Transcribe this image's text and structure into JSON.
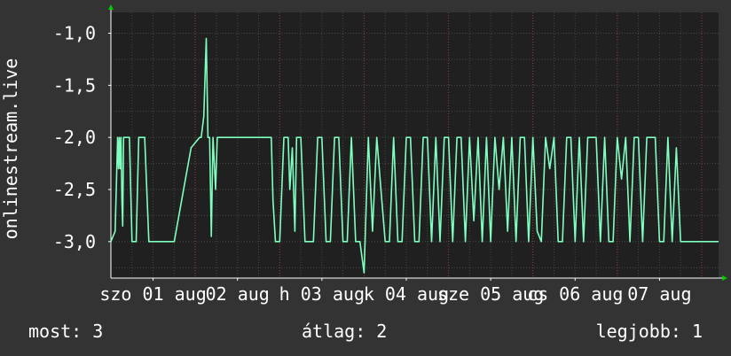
{
  "chart_data": {
    "type": "line",
    "ylabel": "onlinestream.live",
    "ylim": [
      -3.35,
      -0.8
    ],
    "y_ticks": [
      {
        "value": -1.0,
        "label": "-1,0"
      },
      {
        "value": -1.5,
        "label": "-1,5"
      },
      {
        "value": -2.0,
        "label": "-2,0"
      },
      {
        "value": -2.5,
        "label": "-2,5"
      },
      {
        "value": -3.0,
        "label": "-3,0"
      }
    ],
    "x_tick_labels": [
      "szo 01 aug",
      "02 aug",
      "h 03 aug",
      "k 04 aug",
      "sze 05 aug",
      "cs 06 aug",
      "07 aug"
    ],
    "x_tick_positions": [
      0.5,
      1.5,
      2.5,
      3.5,
      4.5,
      5.5,
      6.5
    ],
    "xlim": [
      0,
      7.2
    ],
    "grid": true,
    "line_color": "#7fffbf",
    "series": [
      {
        "x": [
          0,
          0.05,
          0.08,
          0.09,
          0.1,
          0.11,
          0.12,
          0.13,
          0.14,
          0.15,
          0.16,
          0.18,
          0.2,
          0.22,
          0.25,
          0.3,
          0.33,
          0.35,
          0.4,
          0.45,
          0.6,
          0.75,
          0.95,
          1.05,
          1.07,
          1.1,
          1.13,
          1.15,
          1.17,
          1.19,
          1.21,
          1.24,
          1.26,
          1.28,
          1.3,
          1.33,
          1.36,
          1.38,
          1.4,
          1.42,
          1.45,
          1.5,
          1.7,
          1.9,
          1.92,
          1.95,
          2.0,
          2.05,
          2.1,
          2.12,
          2.15,
          2.18,
          2.2,
          2.22,
          2.25,
          2.3,
          2.4,
          2.45,
          2.5,
          2.55,
          2.6,
          2.65,
          2.7,
          2.75,
          2.8,
          2.85,
          2.9,
          2.95,
          3.0,
          3.05,
          3.1,
          3.15,
          3.2,
          3.25,
          3.3,
          3.35,
          3.4,
          3.45,
          3.5,
          3.55,
          3.6,
          3.65,
          3.7,
          3.75,
          3.8,
          3.85,
          3.9,
          3.95,
          4.0,
          4.05,
          4.1,
          4.15,
          4.2,
          4.25,
          4.3,
          4.35,
          4.4,
          4.45,
          4.5,
          4.55,
          4.6,
          4.65,
          4.7,
          4.75,
          4.8,
          4.85,
          4.9,
          4.95,
          5.0,
          5.05,
          5.1,
          5.15,
          5.2,
          5.25,
          5.3,
          5.35,
          5.4,
          5.45,
          5.5,
          5.55,
          5.6,
          5.65,
          5.7,
          5.75,
          5.8,
          5.85,
          5.9,
          5.95,
          6.0,
          6.05,
          6.1,
          6.15,
          6.2,
          6.25,
          6.3,
          6.35,
          6.4,
          6.45,
          6.5,
          6.55,
          6.6,
          6.65,
          6.7,
          6.75,
          6.8,
          6.85,
          6.9,
          7.2
        ],
        "y": [
          -3.0,
          -2.9,
          -2.0,
          -2.3,
          -2.0,
          -2.3,
          -2.0,
          -2.6,
          -2.85,
          -2.0,
          -2.0,
          -2.0,
          -2.0,
          -2.0,
          -3.0,
          -3.0,
          -2.0,
          -2.0,
          -2.0,
          -3.0,
          -3.0,
          -3.0,
          -2.1,
          -2.0,
          -2.0,
          -1.8,
          -1.05,
          -2.0,
          -2.0,
          -2.95,
          -2.0,
          -2.5,
          -2.0,
          -2.0,
          -2.0,
          -2.0,
          -2.0,
          -2.0,
          -2.0,
          -2.0,
          -2.0,
          -2.0,
          -2.0,
          -2.0,
          -2.6,
          -3.0,
          -3.0,
          -2.0,
          -2.0,
          -2.5,
          -2.1,
          -2.9,
          -2.0,
          -2.0,
          -2.0,
          -3.0,
          -3.0,
          -2.0,
          -2.0,
          -3.0,
          -3.0,
          -2.0,
          -2.0,
          -3.0,
          -3.0,
          -2.0,
          -3.0,
          -3.0,
          -3.3,
          -2.0,
          -2.9,
          -2.0,
          -2.5,
          -3.0,
          -3.0,
          -2.0,
          -3.0,
          -3.0,
          -2.0,
          -2.0,
          -3.0,
          -3.0,
          -2.0,
          -2.0,
          -3.0,
          -2.0,
          -3.0,
          -2.0,
          -2.0,
          -3.0,
          -2.0,
          -2.0,
          -3.0,
          -2.0,
          -2.8,
          -2.0,
          -3.0,
          -2.0,
          -3.0,
          -2.0,
          -2.5,
          -2.0,
          -2.9,
          -2.0,
          -3.0,
          -2.0,
          -2.0,
          -3.0,
          -2.0,
          -2.9,
          -3.0,
          -2.0,
          -2.3,
          -2.0,
          -3.0,
          -3.0,
          -2.0,
          -2.0,
          -3.0,
          -2.0,
          -3.0,
          -2.0,
          -2.0,
          -2.0,
          -3.0,
          -2.0,
          -3.0,
          -3.0,
          -2.0,
          -2.4,
          -2.0,
          -3.0,
          -2.0,
          -2.0,
          -3.0,
          -2.0,
          -2.0,
          -2.0,
          -3.0,
          -3.0,
          -2.0,
          -3.0,
          -2.1,
          -3.0,
          -3.0,
          -3.0,
          -3.0,
          -3.0
        ]
      }
    ]
  },
  "stats": {
    "now": "most: 3",
    "avg": "átlag: 2",
    "best": "legjobb: 1"
  }
}
